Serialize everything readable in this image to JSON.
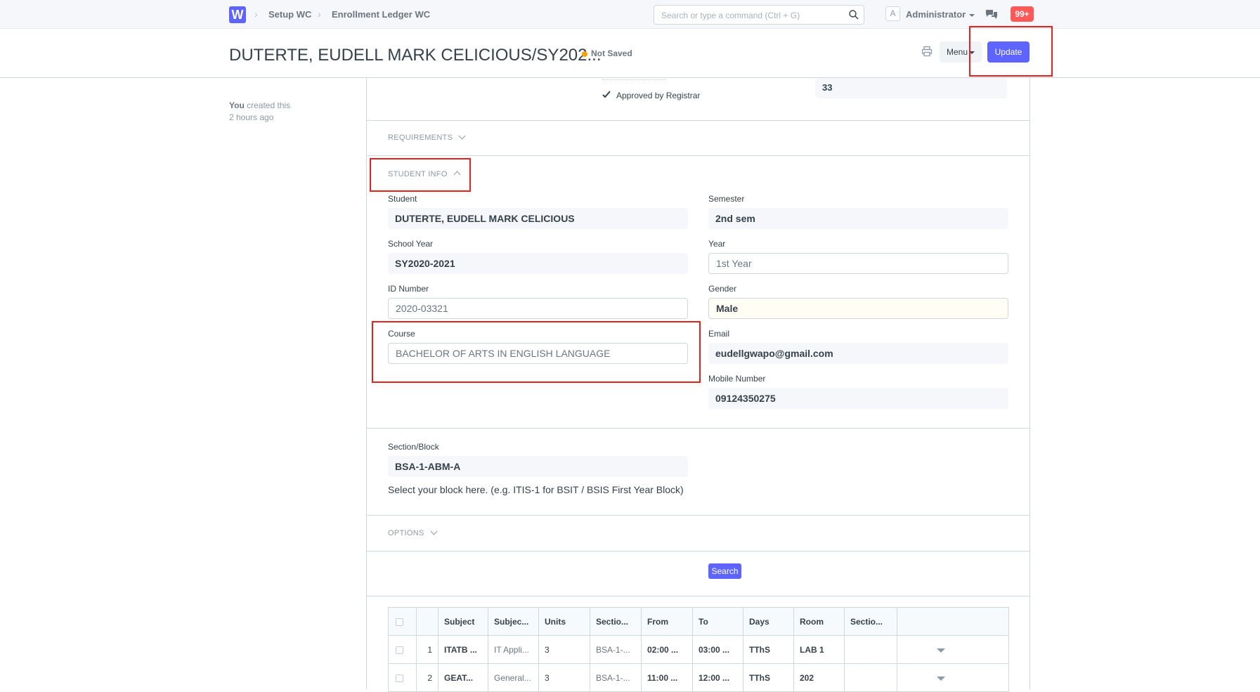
{
  "navbar": {
    "logo_letter": "W",
    "breadcrumbs": [
      "Setup WC",
      "Enrollment Ledger WC"
    ],
    "search_placeholder": "Search or type a command (Ctrl + G)",
    "user_initial": "A",
    "user_name": "Administrator",
    "notification_count": "99+"
  },
  "page_head": {
    "title": "DUTERTE, EUDELL MARK CELICIOUS/SY202...",
    "status": "Not Saved",
    "menu_label": "Menu",
    "update_label": "Update"
  },
  "sidebar": {
    "created_by": "You",
    "created_text": "created this",
    "created_time": "2 hours ago"
  },
  "top_section": {
    "approved_label": "Approved by Registrar",
    "value_33": "33"
  },
  "sections": {
    "requirements": "REQUIREMENTS",
    "student_info": "STUDENT INFO",
    "options": "OPTIONS"
  },
  "student_info": {
    "student_label": "Student",
    "student_value": "DUTERTE, EUDELL MARK CELICIOUS",
    "school_year_label": "School Year",
    "school_year_value": "SY2020-2021",
    "id_label": "ID Number",
    "id_value": "2020-03321",
    "course_label": "Course",
    "course_value": "BACHELOR OF ARTS IN ENGLISH LANGUAGE",
    "semester_label": "Semester",
    "semester_value": "2nd sem",
    "year_label": "Year",
    "year_value": "1st Year",
    "gender_label": "Gender",
    "gender_value": "Male",
    "email_label": "Email",
    "email_value": "eudellgwapo@gmail.com",
    "mobile_label": "Mobile Number",
    "mobile_value": "09124350275"
  },
  "section_block": {
    "label": "Section/Block",
    "value": "BSA-1-ABM-A",
    "help": "Select your block here. (e.g. ITIS-1 for BSIT / BSIS First Year Block)"
  },
  "options": {
    "search_label": "Search"
  },
  "table": {
    "headers": [
      "Subject",
      "Subjec...",
      "Units",
      "Sectio...",
      "From",
      "To",
      "Days",
      "Room",
      "Sectio..."
    ],
    "rows": [
      {
        "idx": "1",
        "subject": "ITATB ...",
        "subject_desc": "IT Appli...",
        "units": "3",
        "section": "BSA-1-...",
        "from": "02:00 ...",
        "to": "03:00 ...",
        "days": "TThS",
        "room": "LAB 1",
        "section2": ""
      },
      {
        "idx": "2",
        "subject": "GEAT...",
        "subject_desc": "General...",
        "units": "3",
        "section": "BSA-1-...",
        "from": "11:00 ...",
        "to": "12:00 ...",
        "days": "TThS",
        "room": "202",
        "section2": ""
      }
    ]
  },
  "colors": {
    "primary": "#5e64ff",
    "badge": "#ff5858",
    "status_dot": "#ffa00a",
    "annotation": "#e8201e"
  }
}
